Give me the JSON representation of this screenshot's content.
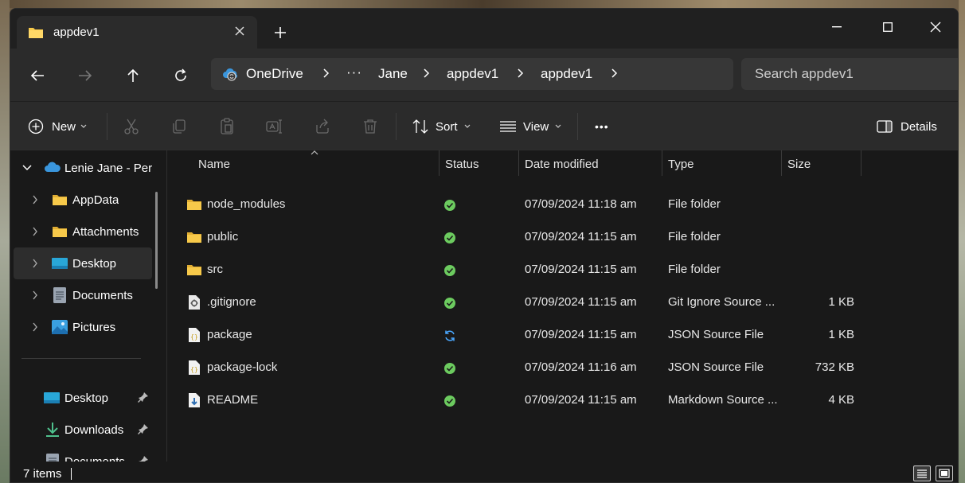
{
  "window": {
    "tab_title": "appdev1",
    "new_tab_label": "+"
  },
  "nav": {
    "breadcrumb": {
      "root": "OneDrive",
      "overflow": "···",
      "items": [
        "Jane",
        "appdev1",
        "appdev1"
      ]
    },
    "search_placeholder": "Search appdev1"
  },
  "commands": {
    "new_label": "New",
    "sort_label": "Sort",
    "view_label": "View",
    "more_label": "•••",
    "details_label": "Details"
  },
  "sidebar": {
    "root_label": "Lenie Jane - Pers",
    "tree_items": [
      {
        "label": "AppData",
        "icon": "folder-icon"
      },
      {
        "label": "Attachments",
        "icon": "folder-icon"
      },
      {
        "label": "Desktop",
        "icon": "desktop-icon"
      },
      {
        "label": "Documents",
        "icon": "documents-icon"
      },
      {
        "label": "Pictures",
        "icon": "pictures-icon"
      }
    ],
    "quick_access": [
      {
        "label": "Desktop",
        "icon": "desktop-icon"
      },
      {
        "label": "Downloads",
        "icon": "download-icon"
      },
      {
        "label": "Documents",
        "icon": "documents-icon"
      }
    ]
  },
  "columns": {
    "name": "Name",
    "status": "Status",
    "date": "Date modified",
    "type": "Type",
    "size": "Size"
  },
  "files": [
    {
      "name": "node_modules",
      "icon": "folder-icon",
      "status": "synced",
      "date": "07/09/2024 11:18 am",
      "type": "File folder",
      "size": ""
    },
    {
      "name": "public",
      "icon": "folder-icon",
      "status": "synced",
      "date": "07/09/2024 11:15 am",
      "type": "File folder",
      "size": ""
    },
    {
      "name": "src",
      "icon": "folder-icon",
      "status": "synced",
      "date": "07/09/2024 11:15 am",
      "type": "File folder",
      "size": ""
    },
    {
      "name": ".gitignore",
      "icon": "gear-file-icon",
      "status": "synced",
      "date": "07/09/2024 11:15 am",
      "type": "Git Ignore Source ...",
      "size": "1 KB"
    },
    {
      "name": "package",
      "icon": "json-file-icon",
      "status": "syncing",
      "date": "07/09/2024 11:15 am",
      "type": "JSON Source File",
      "size": "1 KB"
    },
    {
      "name": "package-lock",
      "icon": "json-file-icon",
      "status": "synced",
      "date": "07/09/2024 11:16 am",
      "type": "JSON Source File",
      "size": "732 KB"
    },
    {
      "name": "README",
      "icon": "markdown-file-icon",
      "status": "synced",
      "date": "07/09/2024 11:15 am",
      "type": "Markdown Source ...",
      "size": "4 KB"
    }
  ],
  "statusbar": {
    "item_count": "7 items"
  },
  "colors": {
    "accent": "#4cc2ff",
    "synced": "#6ccb5f",
    "folder": "#f7c94a",
    "onedrive": "#3a96dd"
  }
}
